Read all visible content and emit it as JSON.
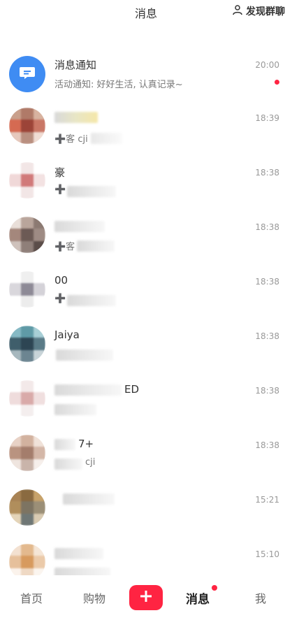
{
  "header": {
    "title": "消息",
    "discover_label": "发现群聊"
  },
  "system_notification": {
    "name": "消息通知",
    "preview": "活动通知: 好好生活, 认真记录~",
    "time": "20:00"
  },
  "conversations": [
    {
      "name_fragment": "",
      "preview_fragment": "➕客 cji",
      "time": "18:39"
    },
    {
      "name_fragment": "豪",
      "preview_fragment": "➕",
      "time": "18:38"
    },
    {
      "name_fragment": "",
      "preview_fragment": "➕客",
      "time": "18:38"
    },
    {
      "name_fragment": "00",
      "preview_fragment": "➕",
      "time": "18:38"
    },
    {
      "name_fragment": "Jaiya",
      "preview_fragment": "",
      "time": "18:38"
    },
    {
      "name_fragment": "ED",
      "preview_fragment": "",
      "time": "18:38"
    },
    {
      "name_fragment": "7+",
      "preview_fragment": "cji",
      "time": "18:38"
    },
    {
      "name_fragment": "",
      "preview_fragment": "",
      "time": "15:21"
    },
    {
      "name_fragment": "",
      "preview_fragment": "",
      "time": "15:10"
    }
  ],
  "tabbar": {
    "home": "首页",
    "shop": "购物",
    "messages": "消息",
    "me": "我"
  },
  "colors": {
    "accent": "#ff2442",
    "notify_blue": "#3f8cf3"
  }
}
